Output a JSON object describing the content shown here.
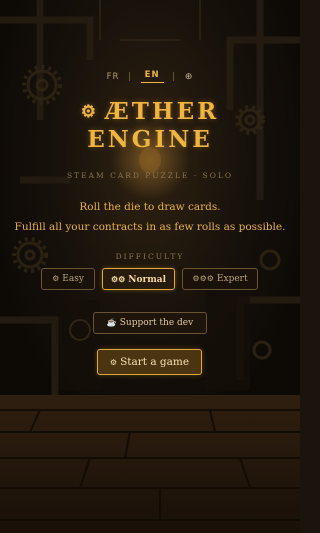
{
  "language_switcher": {
    "options": [
      "FR",
      "EN"
    ],
    "active": "EN",
    "separator": "|",
    "globe_icon": "globe-icon"
  },
  "title": {
    "line1": "ÆTHER",
    "line2": "ENGINE",
    "gear_icon": "gear-icon"
  },
  "subtitle": "STEAM CARD PUZZLE · SOLO",
  "tagline": {
    "line1": "Roll the die to draw cards.",
    "line2": "Fulfill all your contracts in as few rolls as possible."
  },
  "difficulty": {
    "label": "DIFFICULTY",
    "options": [
      {
        "label": "Easy",
        "icon": "single-gear-icon",
        "glyph": "⚙"
      },
      {
        "label": "Normal",
        "icon": "double-gear-icon",
        "glyph": "⚙⚙"
      },
      {
        "label": "Expert",
        "icon": "triple-gear-icon",
        "glyph": "⚙⚙⚙"
      }
    ],
    "selected": "Normal"
  },
  "buttons": {
    "support": {
      "label": "Support the dev",
      "icon": "coffee-icon",
      "glyph": "☕"
    },
    "start": {
      "label": "Start a game",
      "icon": "gear-icon",
      "glyph": "⚙"
    }
  },
  "colors": {
    "accent": "#e0a93a",
    "background": "#1a140d",
    "muted_text": "#8c7654",
    "button_border": "#6a5532"
  }
}
